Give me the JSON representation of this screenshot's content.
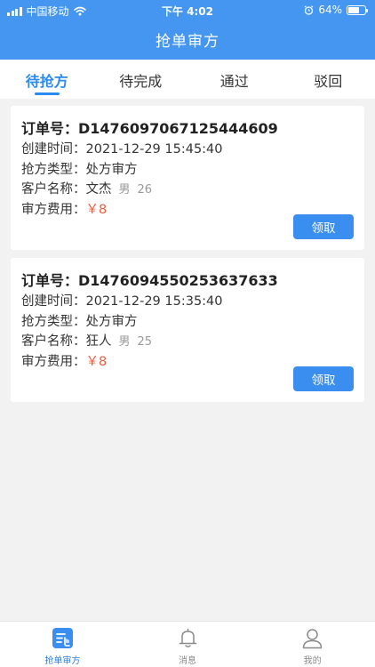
{
  "status_bar": {
    "carrier": "中国移动",
    "time": "下午 4:02",
    "battery": "64%",
    "battery_level": 0.64
  },
  "header": {
    "title": "抢单审方"
  },
  "tabs": [
    {
      "label": "待抢方",
      "active": true
    },
    {
      "label": "待完成",
      "active": false
    },
    {
      "label": "通过",
      "active": false
    },
    {
      "label": "驳回",
      "active": false
    }
  ],
  "orders": [
    {
      "order_no": "订单号：D1476097067125444609",
      "created_label": "创建时间：",
      "created": "2021-12-29 15:45:40",
      "type_label": "抢方类型：",
      "type": "处方审方",
      "customer_label": "客户名称：",
      "customer": "文杰",
      "gender": "男",
      "age": "26",
      "fee_label": "审方费用：",
      "fee": "￥8",
      "action": "领取"
    },
    {
      "order_no": "订单号：D1476094550253637633",
      "created_label": "创建时间：",
      "created": "2021-12-29 15:35:40",
      "type_label": "抢方类型：",
      "type": "处方审方",
      "customer_label": "客户名称：",
      "customer": "狂人",
      "gender": "男",
      "age": "25",
      "fee_label": "审方费用：",
      "fee": "￥8",
      "action": "领取"
    }
  ],
  "tabbar": [
    {
      "label": "抢单审方",
      "icon": "order-list-icon",
      "active": true
    },
    {
      "label": "消息",
      "icon": "bell-icon",
      "active": false
    },
    {
      "label": "我的",
      "icon": "user-icon",
      "active": false
    }
  ],
  "colors": {
    "primary": "#4496f0",
    "accent": "#2a8af0",
    "price": "#f05a3a"
  }
}
